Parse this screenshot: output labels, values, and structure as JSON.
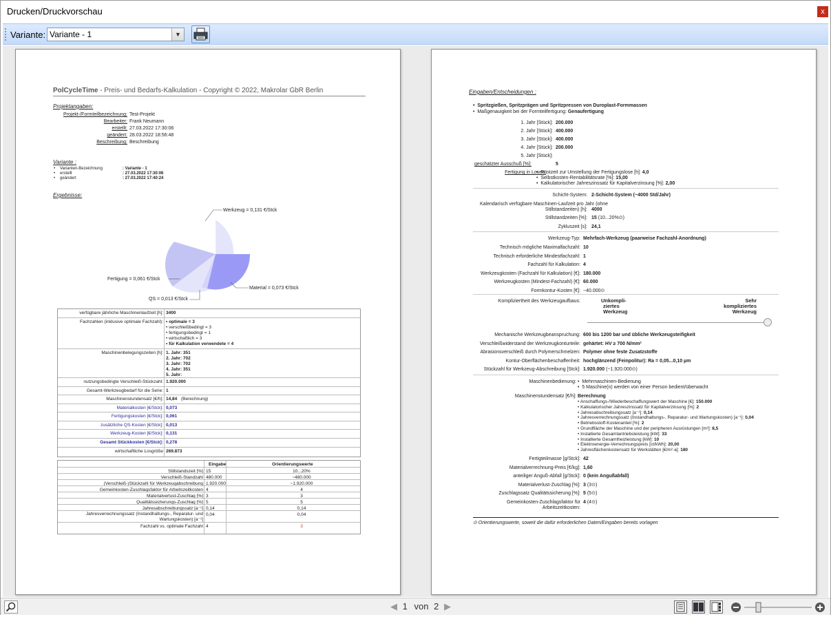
{
  "window": {
    "title": "Drucken/Druckvorschau",
    "close": "x"
  },
  "toolbar": {
    "variant_label": "Variante:",
    "variant_value": "Variante - 1"
  },
  "status": {
    "page_current": "1",
    "page_of": "von",
    "page_total": "2"
  },
  "page1": {
    "header": "PolCycleTime - Preis- und Bedarfs-Kalkulation - Copyright © 2022, Makrolar GbR Berlin",
    "header_bold": "PolCycleTime",
    "header_rest": " - Preis- und Bedarfs-Kalkulation - Copyright © 2022, Makrolar GbR Berlin",
    "projektangaben_title": "Projektangaben:",
    "projekt": [
      {
        "label": "Projekt-/Formteilbezeichnung:",
        "value": "Test-Projekt"
      },
      {
        "label": "Bearbeiter:",
        "value": "Frank Neumann"
      },
      {
        "label": "erstellt:",
        "value": "27.03.2022 17:30:06"
      },
      {
        "label": "geändert:",
        "value": "28.03.2022 18:56:48"
      },
      {
        "label": "Beschreibung:",
        "value": "Beschreibung"
      }
    ],
    "variante_title": "Variante",
    "variante_colon": ":",
    "variante": [
      {
        "label": "Varianten-Bezeichnung",
        "value": ": Variante - 1"
      },
      {
        "label": "erstellt",
        "value": ": 27.03.2022 17:30:06"
      },
      {
        "label": "geändert",
        "value": ": 27.03.2022 17:40:24"
      }
    ],
    "ergebnisse_title": "Ergebnisse:",
    "pie_labels": {
      "werkzeug": "Werkzeug = 0,131 €/Stck",
      "fertigung": "Fertigung = 0,061 €/Stck",
      "qs": "QS = 0,013 €/Stck",
      "material": "Material = 0,073 €/Stck"
    },
    "results": [
      {
        "label": "verfügbare jährliche Maschinenlaufzeit [h]:",
        "value": "3400"
      },
      {
        "label": "Fachzahlen (inklusive optimale Fachzahl):",
        "lines": [
          "• optimale = 3",
          "• verschleißbedingt = 3",
          "• fertigungsbedingt = 1",
          "• wirtschaftlich = 3",
          "• für Kalkulation verwendete = 4"
        ]
      },
      {
        "label": "Maschinenbelegungszeiten [h]:",
        "lines": [
          "1. Jahr: 351",
          "2. Jahr: 702",
          "3. Jahr: 702",
          "4. Jahr: 351",
          "5. Jahr:"
        ]
      },
      {
        "label": "nutzungsbedingte Verschleiß-Stückzahl:",
        "value": "1.920.000"
      },
      {
        "label": "Gesamt-Werkzeugbedarf für die Serie:",
        "value": "1"
      },
      {
        "label": "Maschinenstundensatz [€/h]:",
        "value": "14,84",
        "extra": "(Berechnung)"
      },
      {
        "label": "Materialkosten [€/Stck]:",
        "value": "0,073"
      },
      {
        "label": "Fertigungskosten [€/Stck]:",
        "value": "0,061"
      },
      {
        "label": "zusätzliche QS-Kosten [€/Stck]:",
        "value": "0,013"
      },
      {
        "label": "Werkzeug-Kosten [€/Stck]:",
        "value": "0,131"
      },
      {
        "label": "Gesamt Stückkosten [€/Stck]:",
        "value": "0,278"
      },
      {
        "label": "wirtschaftliche Losgröße",
        "value": "269.873"
      }
    ],
    "compare_headers": [
      "Eingabe",
      "Orientierungswerte"
    ],
    "compare": [
      {
        "label": "Stillstandszeit [%]",
        "eingabe": "15",
        "orient": "10...20%"
      },
      {
        "label": "Verschleiß-Standzahl",
        "eingabe": "480.000",
        "orient": "~480.000"
      },
      {
        "label": "(Verschleiß-)Stückzahl für Werkzeugabschreibung",
        "eingabe": "1.920.000",
        "orient": "~1.920.000"
      },
      {
        "label": "Gemeinkosten-Zuschlagsfaktor für Arbeitszeitkosten",
        "eingabe": "4",
        "orient": "4"
      },
      {
        "label": "Materialverlust-Zuschlag [%]",
        "eingabe": "3",
        "orient": "3"
      },
      {
        "label": "Qualitätssicherungs-Zuschlag [%]",
        "eingabe": "5",
        "orient": "5"
      },
      {
        "label": "Jahresabschreibungssatz [a⁻¹]",
        "eingabe": "0,14",
        "orient": "0,14"
      },
      {
        "label": "Jahresverrechnungssatz (Instandhaltungs-, Reparatur- und Wartungskosten) [a⁻¹]",
        "eingabe": "0,04",
        "orient": "0,04"
      },
      {
        "label": "Fachzahl vs. optimale Fachzahl",
        "eingabe": "4",
        "orient": "3"
      }
    ]
  },
  "page2": {
    "title": "Eingaben/Entscheidungen :",
    "bullets": [
      "Spritzgießen, Spritzprägen und Spritzpressen von Duroplast-Formmassen",
      "Maßgenauigkeit bei der Formteilfertigung: ",
      "Genaufertigung"
    ],
    "years": [
      {
        "label": "1. Jahr [Stück]:",
        "value": "200.000"
      },
      {
        "label": "2. Jahr [Stück]:",
        "value": "400.000"
      },
      {
        "label": "3. Jahr [Stück]:",
        "value": "400.000"
      },
      {
        "label": "4. Jahr [Stück]:",
        "value": "200.000"
      },
      {
        "label": "5. Jahr [Stück]:",
        "value": ""
      }
    ],
    "ausschuss_label": "geschätzter Ausschuß [%]:",
    "ausschuss_value": "5",
    "lose_label": "Fertigung in Losen:",
    "lose": [
      "Rüstzeit zur Umstellung der Fertigungslose [h]: ",
      "4,0",
      "Selbstkosten-Rentabilitätsrate [%]: ",
      "15,00",
      "Kalkulatorischer Jahreszinssatz für Kapitalverzinsung [%]: ",
      "2,00"
    ],
    "schicht_label": "Schicht-System:",
    "schicht_value": "2-Schicht-System (~4000 Std/Jahr)",
    "kalender_label": "Kalendarisch verfügbare Maschinen-Laufzeit pro Jahr (ohne",
    "kalender_label2": "Stillstandzeiten) [h]:",
    "kalender_value": "4000",
    "still_label": "Stillstandzeiten [%]:",
    "still_value": "15",
    "still_hint": " (10...20%⊙)",
    "zyklus_label": "Zykluszeit [s]:",
    "zyklus_value": "24,1",
    "werkzeugtyp_label": "Werkzeug-Typ:",
    "werkzeugtyp_value": "Mehrfach-Werkzeug (paarweise Fachzahl-Anordnung)",
    "fach_rows": [
      {
        "label": "Technisch mögliche Maximalfachzahl:",
        "value": "10"
      },
      {
        "label": "Technisch erforderliche Mindestfachzahl:",
        "value": "1"
      },
      {
        "label": "Fachzahl für Kalkulation:",
        "value": "4"
      },
      {
        "label": "Werkzeugkosten (Fachzahl für Kalkulation) [€]:",
        "value": "180.000"
      },
      {
        "label": "Werkzeugkosten (Mindest-Fachzahl) [€]:",
        "value": "60.000"
      },
      {
        "label": "Formkontur-Kosten [€]:",
        "value": "~40.000⊙"
      }
    ],
    "kompl_label": "Kompliziertheit des Werkzeugaufbaus:",
    "kompl_left": [
      "Unkompli-",
      "ziertes",
      "Werkzeug"
    ],
    "kompl_right": [
      "Sehr",
      "kompliziertes",
      "Werkzeug"
    ],
    "mech_rows": [
      {
        "label": "Mechanische Werkzeugbeanspruchung:",
        "value": "600 bis 1200 bar und übliche Werkzeugsteifigkeit"
      },
      {
        "label": "Verschleißwiderstand der Werkzeugkonturteile:",
        "value": "gehärtet: HV ≥ 700 N/mm²"
      },
      {
        "label": "Abrasionsverschleiß durch Polymerschmelzen:",
        "value": "Polymer ohne feste Zusatzstoffe"
      },
      {
        "label": "Kontur-Oberflächenbeschaffenheit:",
        "value": "hochglänzend (Feinpolitur): Ra = 0,05...0,10 µm"
      },
      {
        "label": "Stückzahl für Werkzeug-Abschreibung [Stck]:",
        "value": "1.920.000",
        "hint": " (~1.920.000⊙)"
      }
    ],
    "bed_label": "Maschinenbedienung:",
    "bed": [
      "Mehrmaschinen-Bedienung",
      "5 Maschine(n) werden von einer Person bedient/überwacht"
    ],
    "msatz_label": "Maschinenstundensatz [€/h]:",
    "msatz_title": "Berechnung",
    "msatz": [
      {
        "t": "Anschaffungs-/Wiederbeschaffungswert der Maschine [€]: ",
        "v": "150.000"
      },
      {
        "t": "Kalkulatorischer Jahreszinssatz für Kapitalverzinsung [%]: ",
        "v": "2"
      },
      {
        "t": "Jahresabschreibungssatz [a⁻¹]: ",
        "v": "0,14"
      },
      {
        "t": "Jahresverrechnungssatz (Instandhaltungs-, Reparatur- und Wartungskosten) [a⁻¹]: ",
        "v": "0,04"
      },
      {
        "t": "Betriebsstoff-Kostenanteil [%]: ",
        "v": "2"
      },
      {
        "t": "Grundfläche der Maschine und der peripheren Ausrüstungen [m²]: ",
        "v": "8,5"
      },
      {
        "t": "Installierte Gesamtantriebsleistung [kW]: ",
        "v": "33"
      },
      {
        "t": "Installierte Gesamtheizleistung [kW]: ",
        "v": "10"
      },
      {
        "t": "Elektroenergie-Verrechnungspreis [ct/kWh]: ",
        "v": "20,00"
      },
      {
        "t": "Jahresflächenkostensatz für Werkstätten [€/m²·a]: ",
        "v": "180"
      }
    ],
    "tail": [
      {
        "label": "Fertigteilmasse [g/Stck]:",
        "value": "42"
      },
      {
        "label": "Materialverrechnung-Preis [€/kg]:",
        "value": "1,60"
      },
      {
        "label": "anteiliger Anguß-Abfall [g/Stck]:",
        "value": "0 (kein Angußabfall)"
      },
      {
        "label": "Materialverlust-Zuschlag [%]:",
        "value": "3",
        "hint": " (3⊙)"
      },
      {
        "label": "Zuschlagssatz Qualitätssicherung [%]:",
        "value": "5",
        "hint": " (5⊙)"
      },
      {
        "label": "Gemeinkosten-Zuschlagsfaktor für",
        "label2": "Arbeitszeitkosten:",
        "value": "4",
        "hint": " (4⊙)"
      }
    ],
    "footnote": "⊙ Orientierungswerte, soweit die dafür erforderlichen Daten/Eingaben bereits vorlagen"
  },
  "colors": {
    "accent": "#c42b1c",
    "pie_werkzeug": "#e4e4fb",
    "pie_material": "#9a9af6",
    "pie_qs": "#d4d4f8",
    "pie_fertigung": "#c4c4f4"
  }
}
